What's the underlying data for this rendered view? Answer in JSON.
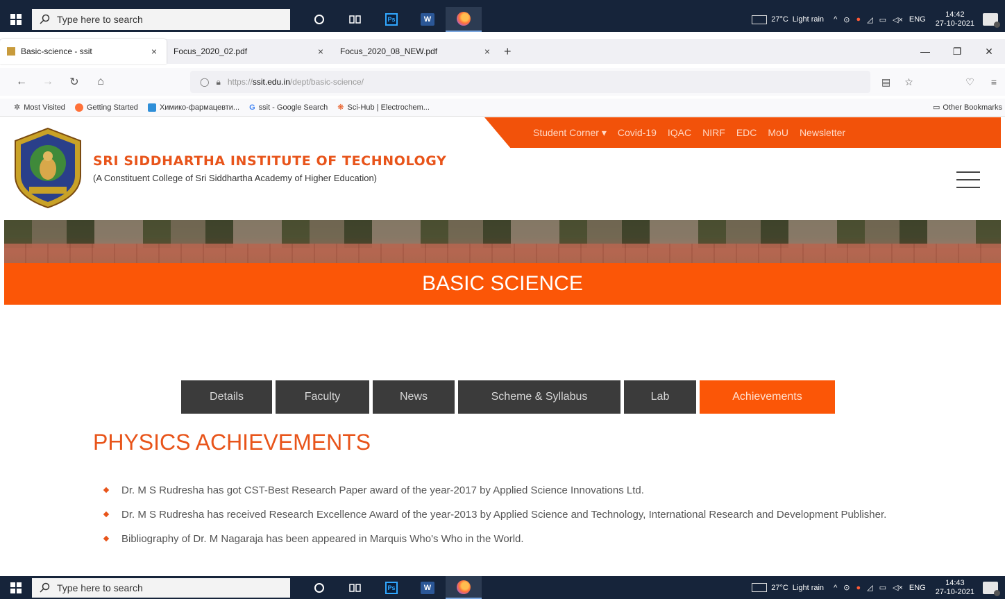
{
  "taskbar": {
    "search_placeholder": "Type here to search",
    "weather_temp": "27°C",
    "weather_desc": "Light rain",
    "lang": "ENG",
    "top_time": "14:42",
    "top_date": "27-10-2021",
    "bottom_time": "14:43",
    "bottom_date": "27-10-2021"
  },
  "browser": {
    "tabs": [
      {
        "label": "Basic-science - ssit"
      },
      {
        "label": "Focus_2020_02.pdf"
      },
      {
        "label": "Focus_2020_08_NEW.pdf"
      }
    ],
    "url_prefix": "https://",
    "url_domain": "ssit.edu.in",
    "url_path": "/dept/basic-science/",
    "bookmarks": [
      {
        "label": "Most Visited",
        "color": "#777777"
      },
      {
        "label": "Getting Started",
        "color": "#ff7139"
      },
      {
        "label": "Химико-фармацевти...",
        "color": "#2f8fd8"
      },
      {
        "label": "ssit - Google Search",
        "color": "#4285f4"
      },
      {
        "label": "Sci-Hub | Electrochem...",
        "color": "#e8541a"
      }
    ],
    "other_bookmarks": "Other Bookmarks"
  },
  "site": {
    "topnav": [
      "Student Corner ▾",
      "Covid-19",
      "IQAC",
      "NIRF",
      "EDC",
      "MoU",
      "Newsletter"
    ],
    "title": "SRI SIDDHARTHA INSTITUTE OF TECHNOLOGY",
    "subtitle": "(A Constituent College of Sri Siddhartha Academy of Higher Education)",
    "banner": "BASIC SCIENCE",
    "dept_tabs": [
      {
        "label": "Details"
      },
      {
        "label": "Faculty"
      },
      {
        "label": "News"
      },
      {
        "label": "Scheme & Syllabus"
      },
      {
        "label": "Lab"
      },
      {
        "label": "Achievements"
      }
    ],
    "active_tab": "Achievements",
    "section_title": "PHYSICS ACHIEVEMENTS",
    "achievements": [
      "Dr. M S Rudresha has got CST-Best Research Paper award of the year-2017 by Applied Science Innovations Ltd.",
      "Dr. M S Rudresha has received Research Excellence Award of the year-2013 by Applied Science and Technology, International Research and Development Publisher.",
      "Bibliography of Dr. M Nagaraja has been appeared in Marquis Who's Who in the World."
    ],
    "accent_color": "#fb5607"
  }
}
